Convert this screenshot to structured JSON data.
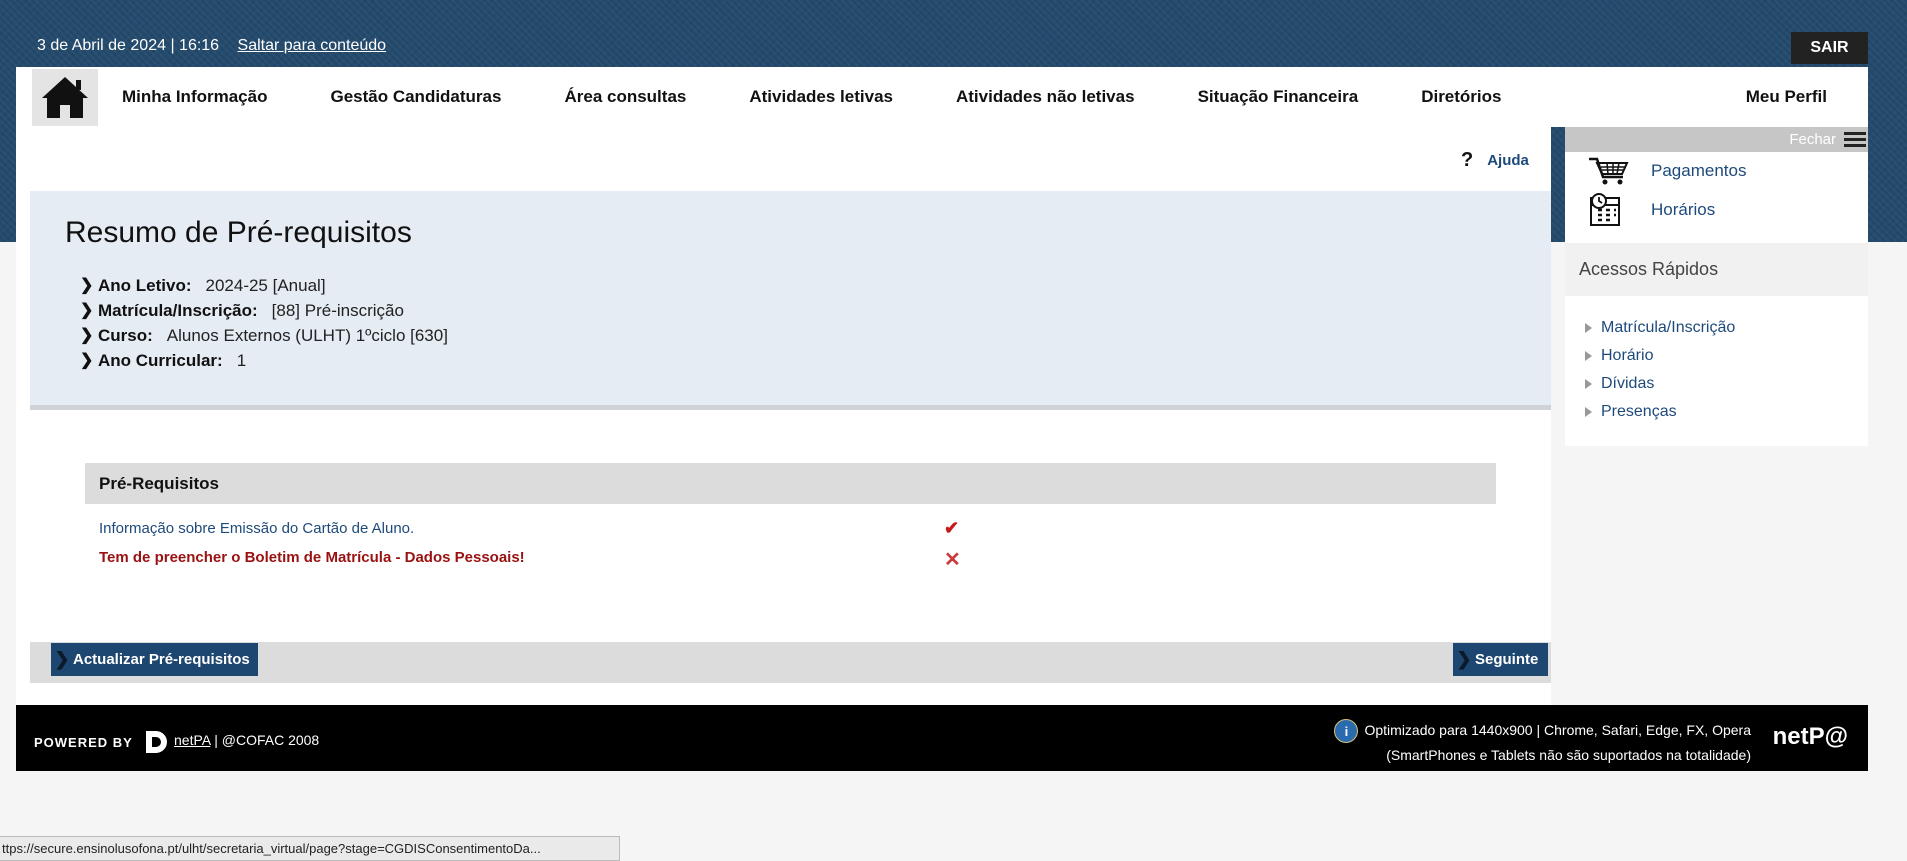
{
  "topbar": {
    "datetime": "3 de Abril de 2024 | 16:16",
    "skip_link": "Saltar para conteúdo",
    "logout": "SAIR"
  },
  "nav": {
    "items": [
      "Minha Informação",
      "Gestão Candidaturas",
      "Área consultas",
      "Atividades letivas",
      "Atividades não letivas",
      "Situação Financeira",
      "Diretórios"
    ],
    "profile": "Meu Perfil"
  },
  "help": {
    "label": "Ajuda"
  },
  "summary": {
    "title": "Resumo de Pré-requisitos",
    "fields": [
      {
        "label": "Ano Letivo:",
        "value": "2024-25 [Anual]"
      },
      {
        "label": "Matrícula/Inscrição:",
        "value": "[88] Pré-inscrição"
      },
      {
        "label": "Curso:",
        "value": "Alunos Externos (ULHT) 1ºciclo [630]"
      },
      {
        "label": "Ano Curricular:",
        "value": "1"
      }
    ]
  },
  "prereqs": {
    "heading": "Pré-Requisitos",
    "rows": [
      {
        "text": "Informação sobre Emissão do Cartão de Aluno.",
        "status": "ok"
      },
      {
        "text": "Tem de preencher o Boletim de Matrícula - Dados Pessoais!",
        "status": "missing"
      }
    ]
  },
  "actions": {
    "refresh": "Actualizar Pré-requisitos",
    "next": "Seguinte"
  },
  "sidepanel": {
    "close": "Fechar",
    "links": [
      "Pagamentos",
      "Horários"
    ],
    "quick_title": "Acessos Rápidos",
    "quick_links": [
      "Matrícula/Inscrição",
      "Horário",
      "Dívidas",
      "Presenças"
    ]
  },
  "footer": {
    "powered": "POWERED BY",
    "product": "netPA",
    "copyright": "| @COFAC 2008",
    "optimized": "Optimizado para 1440x900 | Chrome, Safari, Edge, FX, Opera",
    "mobile_note": "(SmartPhones e Tablets não são suportados na totalidade)",
    "logo": "netP@"
  },
  "statusbar": {
    "url": "ttps://secure.ensinolusofona.pt/ulht/secretaria_virtual/page?stage=CGDISConsentimentoDa..."
  },
  "colors": {
    "brand_blue": "#1d4670",
    "link_blue": "#1e4a7a",
    "error_red": "#9a1111"
  }
}
